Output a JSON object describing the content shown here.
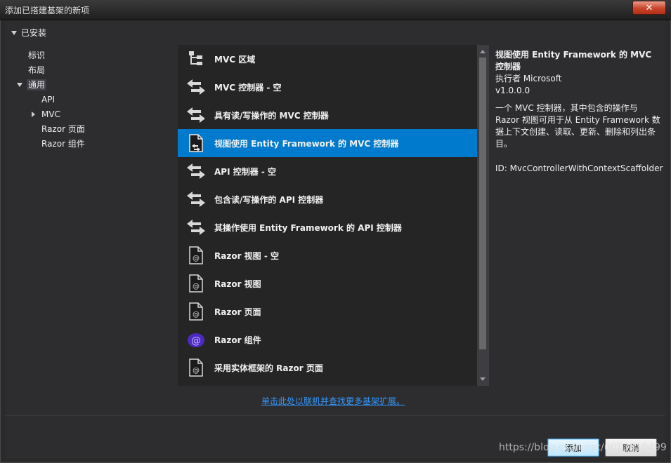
{
  "window": {
    "title": "添加已搭建基架的新项",
    "close_glyph": "✕"
  },
  "tree": {
    "header": "已安装",
    "items": [
      {
        "label": "标识"
      },
      {
        "label": "布局"
      },
      {
        "label": "通用"
      },
      {
        "label": "API"
      },
      {
        "label": "MVC"
      },
      {
        "label": "Razor 页面"
      },
      {
        "label": "Razor 组件"
      }
    ]
  },
  "list": {
    "items": [
      {
        "label": "MVC 区域",
        "icon": "area-icon"
      },
      {
        "label": "MVC 控制器 - 空",
        "icon": "controller-icon"
      },
      {
        "label": "具有读/写操作的 MVC 控制器",
        "icon": "controller-icon"
      },
      {
        "label": "视图使用 Entity Framework 的 MVC 控制器",
        "icon": "controller-views-icon",
        "selected": true
      },
      {
        "label": "API 控制器 - 空",
        "icon": "controller-icon"
      },
      {
        "label": "包含读/写操作的 API 控制器",
        "icon": "controller-icon"
      },
      {
        "label": "其操作使用 Entity Framework 的 API 控制器",
        "icon": "controller-icon"
      },
      {
        "label": "Razor 视图 - 空",
        "icon": "razor-file-icon"
      },
      {
        "label": "Razor 视图",
        "icon": "razor-file-icon"
      },
      {
        "label": "Razor 页面",
        "icon": "razor-file-icon"
      },
      {
        "label": "Razor 组件",
        "icon": "blazor-icon"
      },
      {
        "label": "采用实体框架的 Razor 页面",
        "icon": "razor-file-icon"
      }
    ]
  },
  "details": {
    "title": "视图使用 Entity Framework 的 MVC 控制器",
    "author": "执行者 Microsoft",
    "version": "v1.0.0.0",
    "description": "一个 MVC 控制器，其中包含的操作与 Razor 视图可用于从 Entity Framework 数据上下文创建、读取、更新、删除和列出条目。",
    "id": "ID: MvcControllerWithContextScaffolder"
  },
  "online_link": "单击此处以联机并查找更多基架扩展。",
  "buttons": {
    "add": "添加",
    "cancel": "取消"
  },
  "watermark": "https://blog.csdn.net/u013810499",
  "colors": {
    "selection": "#007acc",
    "link": "#3399ff",
    "background": "#2d2d30"
  }
}
